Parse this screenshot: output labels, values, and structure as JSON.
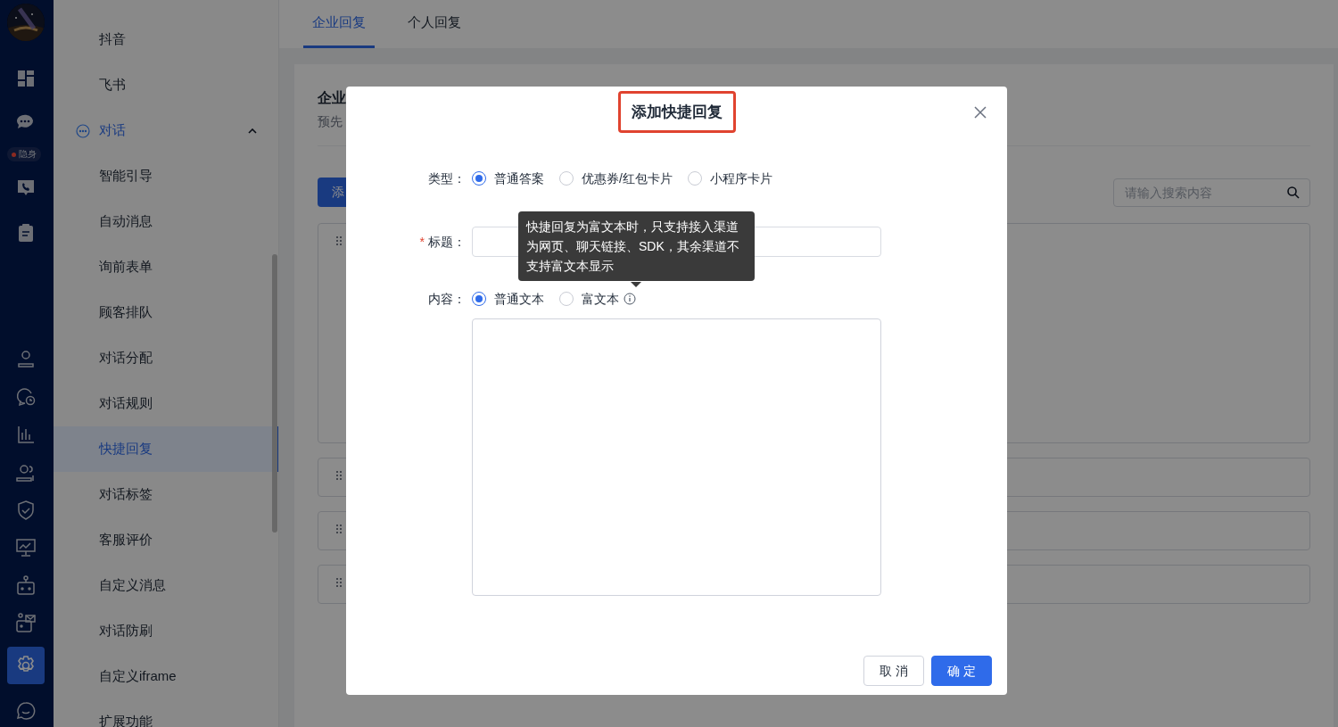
{
  "rail": {
    "status_badge": "隐身",
    "items": [
      {
        "selected": false
      },
      {
        "selected": false
      },
      {
        "selected": false
      },
      {
        "selected": false
      },
      {
        "selected": false
      },
      {
        "selected": false
      },
      {
        "selected": false
      },
      {
        "selected": false
      },
      {
        "selected": false
      },
      {
        "selected": false
      },
      {
        "selected": false
      },
      {
        "selected": false
      },
      {
        "selected": true
      },
      {
        "selected": false
      }
    ]
  },
  "sidebar": {
    "items": [
      {
        "label": "抖音",
        "selected": false
      },
      {
        "label": "飞书",
        "selected": false
      },
      {
        "label": "对话",
        "expanded": true,
        "children": [
          {
            "label": "智能引导",
            "selected": false
          },
          {
            "label": "自动消息",
            "selected": false
          },
          {
            "label": "询前表单",
            "selected": false
          },
          {
            "label": "顾客排队",
            "selected": false
          },
          {
            "label": "对话分配",
            "selected": false
          },
          {
            "label": "对话规则",
            "selected": false
          },
          {
            "label": "快捷回复",
            "selected": true
          },
          {
            "label": "对话标签",
            "selected": false
          },
          {
            "label": "客服评价",
            "selected": false
          },
          {
            "label": "自定义消息",
            "selected": false
          },
          {
            "label": "对话防刷",
            "selected": false
          },
          {
            "label": "自定义iframe",
            "selected": false
          },
          {
            "label": "扩展功能",
            "selected": false
          }
        ]
      }
    ]
  },
  "tabs": [
    {
      "label": "企业回复",
      "selected": true
    },
    {
      "label": "个人回复",
      "selected": false
    }
  ],
  "card": {
    "title": "企业",
    "subtitle": "预先",
    "add_button": "添",
    "search": {
      "placeholder": "请输入搜索内容"
    }
  },
  "dialog": {
    "title": "添加快捷回复",
    "type_field": {
      "label": "类型：",
      "options": [
        {
          "label": "普通答案",
          "selected": true
        },
        {
          "label": "优惠券/红包卡片",
          "selected": false
        },
        {
          "label": "小程序卡片",
          "selected": false
        }
      ]
    },
    "title_field": {
      "label": "标题：",
      "required_mark": "*"
    },
    "tooltip": "快捷回复为富文本时，只支持接入渠道为网页、聊天链接、SDK，其余渠道不支持富文本显示",
    "content_field": {
      "label": "内容：",
      "options": [
        {
          "label": "普通文本",
          "selected": true
        },
        {
          "label": "富文本",
          "selected": false,
          "info": true
        }
      ]
    },
    "buttons": [
      {
        "label": "取 消",
        "kind": "secondary"
      },
      {
        "label": "确 定",
        "kind": "primary"
      }
    ]
  }
}
